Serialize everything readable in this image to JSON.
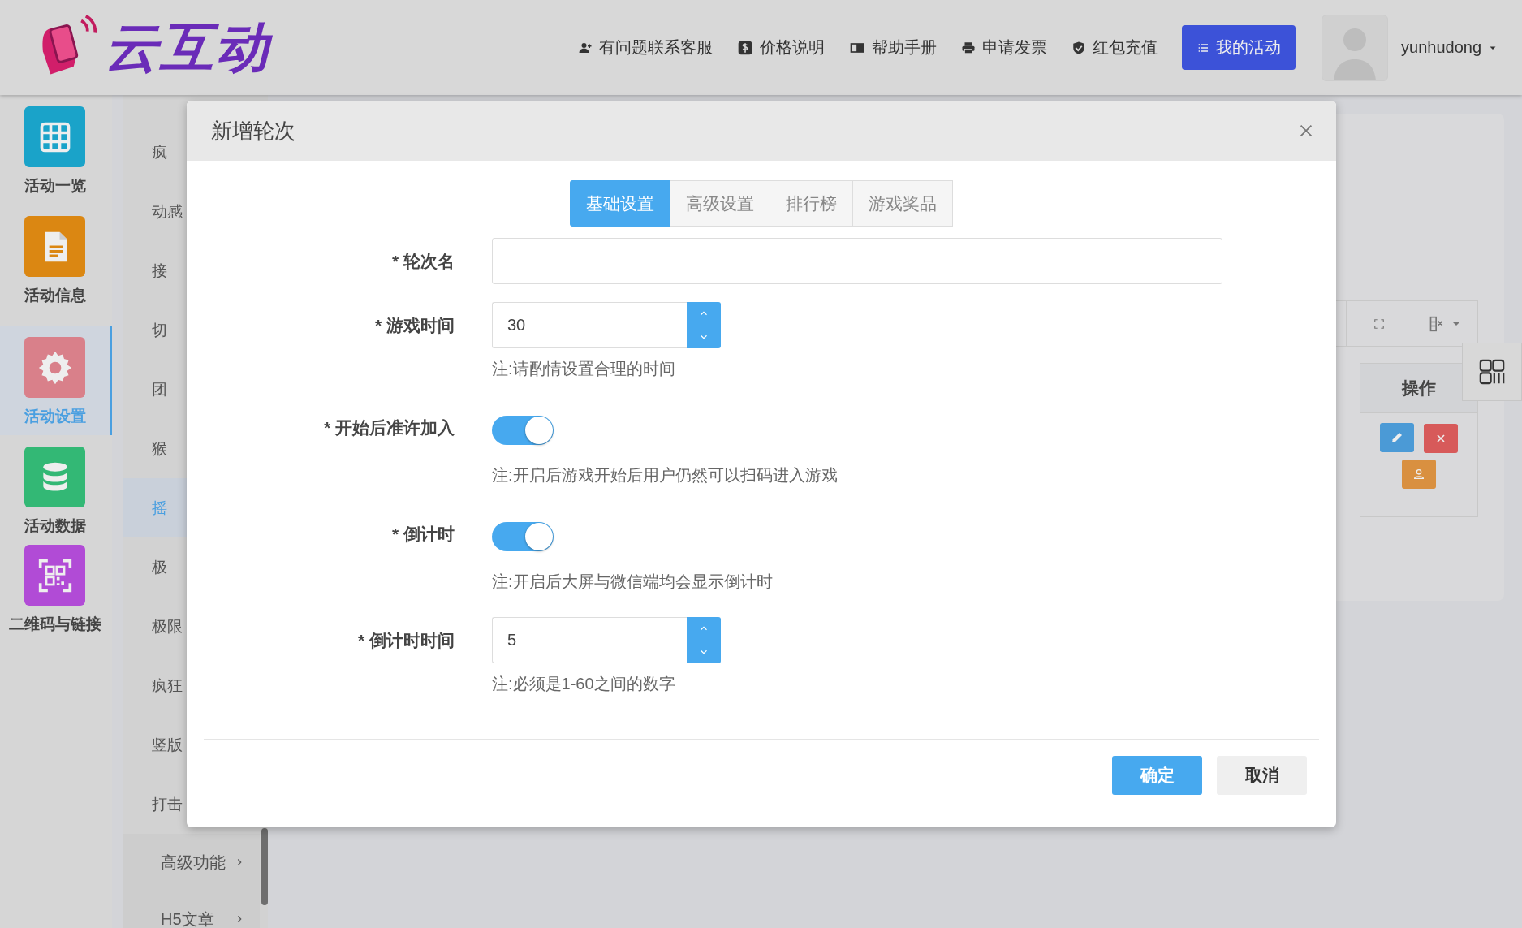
{
  "header": {
    "logo": "云互动",
    "nav": [
      {
        "label": "有问题联系客服"
      },
      {
        "label": "价格说明"
      },
      {
        "label": "帮助手册"
      },
      {
        "label": "申请发票"
      },
      {
        "label": "红包充值"
      }
    ],
    "primary_button": "我的活动",
    "username": "yunhudong"
  },
  "sidebar": {
    "items": [
      {
        "label": "活动一览",
        "color": "#1aa3c9",
        "selected": false
      },
      {
        "label": "活动信息",
        "color": "#db8712",
        "selected": false
      },
      {
        "label": "活动设置",
        "color": "#d9808a",
        "selected": true
      },
      {
        "label": "活动数据",
        "color": "#33b875",
        "selected": false
      },
      {
        "label": "二维码与链接",
        "color": "#b14bd6",
        "selected": false
      }
    ]
  },
  "submenu": {
    "items": [
      {
        "label": "疯",
        "selected": false
      },
      {
        "label": "动感",
        "selected": false
      },
      {
        "label": "接",
        "selected": false
      },
      {
        "label": "切",
        "selected": false
      },
      {
        "label": "团",
        "selected": false
      },
      {
        "label": "猴",
        "selected": false
      },
      {
        "label": "摇",
        "selected": true
      },
      {
        "label": "极",
        "selected": false
      },
      {
        "label": "极限",
        "selected": false
      },
      {
        "label": "疯狂",
        "selected": false
      },
      {
        "label": "竖版",
        "selected": false
      },
      {
        "label": "打击",
        "selected": false
      }
    ],
    "groups": [
      {
        "label": "高级功能"
      },
      {
        "label": "H5文章"
      }
    ]
  },
  "table": {
    "columns": [
      "操作"
    ]
  },
  "modal": {
    "title": "新增轮次",
    "tabs": [
      {
        "label": "基础设置",
        "selected": true
      },
      {
        "label": "高级设置",
        "selected": false
      },
      {
        "label": "排行榜",
        "selected": false
      },
      {
        "label": "游戏奖品",
        "selected": false
      }
    ],
    "fields": [
      {
        "kind": "text",
        "label": "* 轮次名"
      },
      {
        "kind": "number",
        "label": "* 游戏时间",
        "value": "30",
        "hint": "注:请酌情设置合理的时间"
      },
      {
        "kind": "toggle",
        "label": "* 开始后准许加入",
        "on": true,
        "hint": "注:开启后游戏开始后用户仍然可以扫码进入游戏"
      },
      {
        "kind": "toggle",
        "label": "* 倒计时",
        "on": true,
        "hint": "注:开启后大屏与微信端均会显示倒计时"
      },
      {
        "kind": "number",
        "label": "* 倒计时时间",
        "value": "5",
        "hint": "注:必须是1-60之间的数字"
      }
    ],
    "buttons": [
      {
        "label": "确定",
        "kind": "primary"
      },
      {
        "label": "取消",
        "kind": "default"
      }
    ]
  }
}
